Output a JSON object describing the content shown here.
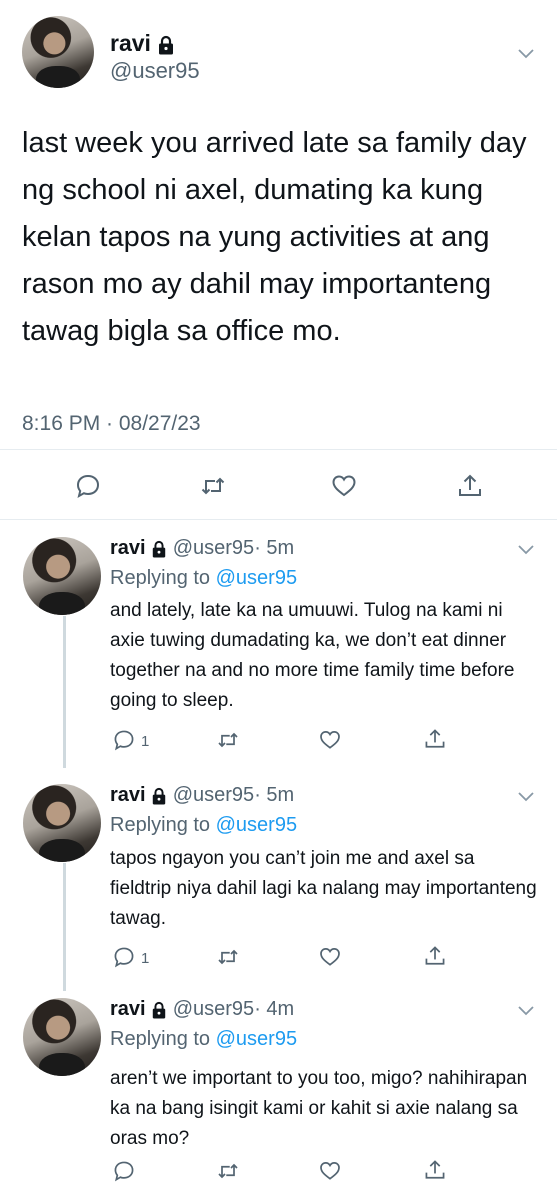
{
  "main_tweet": {
    "name": "ravi",
    "handle": "@user95",
    "text": "last week you arrived late sa family day ng school ni axel, dumating ka kung kelan tapos na yung activities at ang rason mo ay dahil may importanteng tawag bigla sa office mo.",
    "timestamp": "8:16 PM · 08/27/23"
  },
  "replies": [
    {
      "name": "ravi",
      "handle": "@user95",
      "time": "· 5m",
      "replying_prefix": "Replying to ",
      "replying_to": "@user95",
      "text": "and lately, late ka na umuuwi. Tulog na kami ni axie tuwing dumadating ka, we don’t eat dinner together na and no more time family time before going to sleep.",
      "reply_count": "1"
    },
    {
      "name": "ravi",
      "handle": "@user95",
      "time": "· 5m",
      "replying_prefix": "Replying to ",
      "replying_to": "@user95",
      "text": "tapos ngayon you can’t join me and axel sa fieldtrip niya dahil lagi ka nalang may importanteng tawag.",
      "reply_count": "1"
    },
    {
      "name": "ravi",
      "handle": "@user95",
      "time": "· 4m",
      "replying_prefix": "Replying to ",
      "replying_to": "@user95",
      "text": "aren’t we important to you too, migo? nahihirapan ka na bang isingit kami or kahit si axie nalang sa oras mo?",
      "reply_count": ""
    }
  ],
  "icons": {
    "reply": "reply-icon",
    "retweet": "retweet-icon",
    "like": "like-icon",
    "share": "share-icon",
    "lock": "lock-icon",
    "more": "chevron-down-icon"
  },
  "colors": {
    "link": "#1d9bf0",
    "secondary_text": "#536471",
    "divider": "#e6ecf0"
  }
}
